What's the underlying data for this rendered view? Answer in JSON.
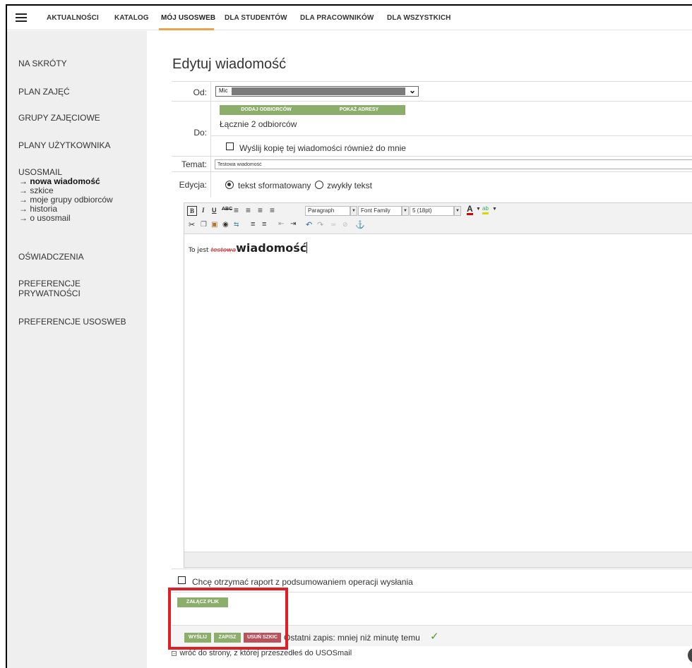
{
  "nav": {
    "items": [
      "AKTUALNOŚCI",
      "KATALOG",
      "MÓJ USOSWEB",
      "DLA STUDENTÓW",
      "DLA PRACOWNIKÓW",
      "DLA WSZYSTKICH"
    ],
    "active_index": 2,
    "accent_color": "#e8a548"
  },
  "sidebar": {
    "links": [
      "NA SKRÓTY",
      "PLAN ZAJĘĆ",
      "GRUPY ZAJĘCIOWE",
      "PLANY UŻYTKOWNIKA",
      "USOSMAIL"
    ],
    "usosmail_sub": [
      "→ nowa wiadomość",
      "→ szkice",
      "→ moje grupy odbiorców",
      "→ historia",
      "→ o usosmail"
    ],
    "links_after": [
      "OŚWIADCZENIA",
      "PREFERENCJE",
      "PRYWATNOŚCI",
      "PREFERENCJE USOSWEB"
    ]
  },
  "page": {
    "title": "Edytuj wiadomość"
  },
  "form": {
    "from_label": "Od:",
    "from_value": "Mic",
    "to_label": "Do:",
    "add_recipients_btn": "DODAJ ODBIORCÓW",
    "show_addresses_btn": "POKAŻ ADRESY",
    "recipients_summary": "Łącznie 2 odbiorców",
    "copy_to_me": "Wyślij kopię tej wiadomości również do mnie",
    "subject_label": "Temat:",
    "subject_value": "Testowa wiadomość",
    "edit_label": "Edycja:",
    "mode_formatted": "tekst sformatowany",
    "mode_plain": "zwykły tekst",
    "report_checkbox": "Chcę otrzymać raport z podsumowaniem operacji wysłania",
    "attach_btn": "ZAŁĄCZ PLIK",
    "send_btn": "WYŚLIJ",
    "save_btn": "ZAPISZ",
    "delete_draft_btn": "USUŃ SZKIC",
    "last_save": "Ostatni zapis: mniej niż minutę temu",
    "checkmark": "✓",
    "back_link": "wróć do strony, z której przeszedłeś do USOSmail"
  },
  "editor": {
    "format_select": "Paragraph",
    "font_family_select": "Font Family",
    "font_size_select": "5 (18pt)",
    "content": {
      "plain": "To jest ",
      "strike": "testowa",
      "bold": "wiadomość"
    }
  },
  "help": {
    "label": "?"
  }
}
